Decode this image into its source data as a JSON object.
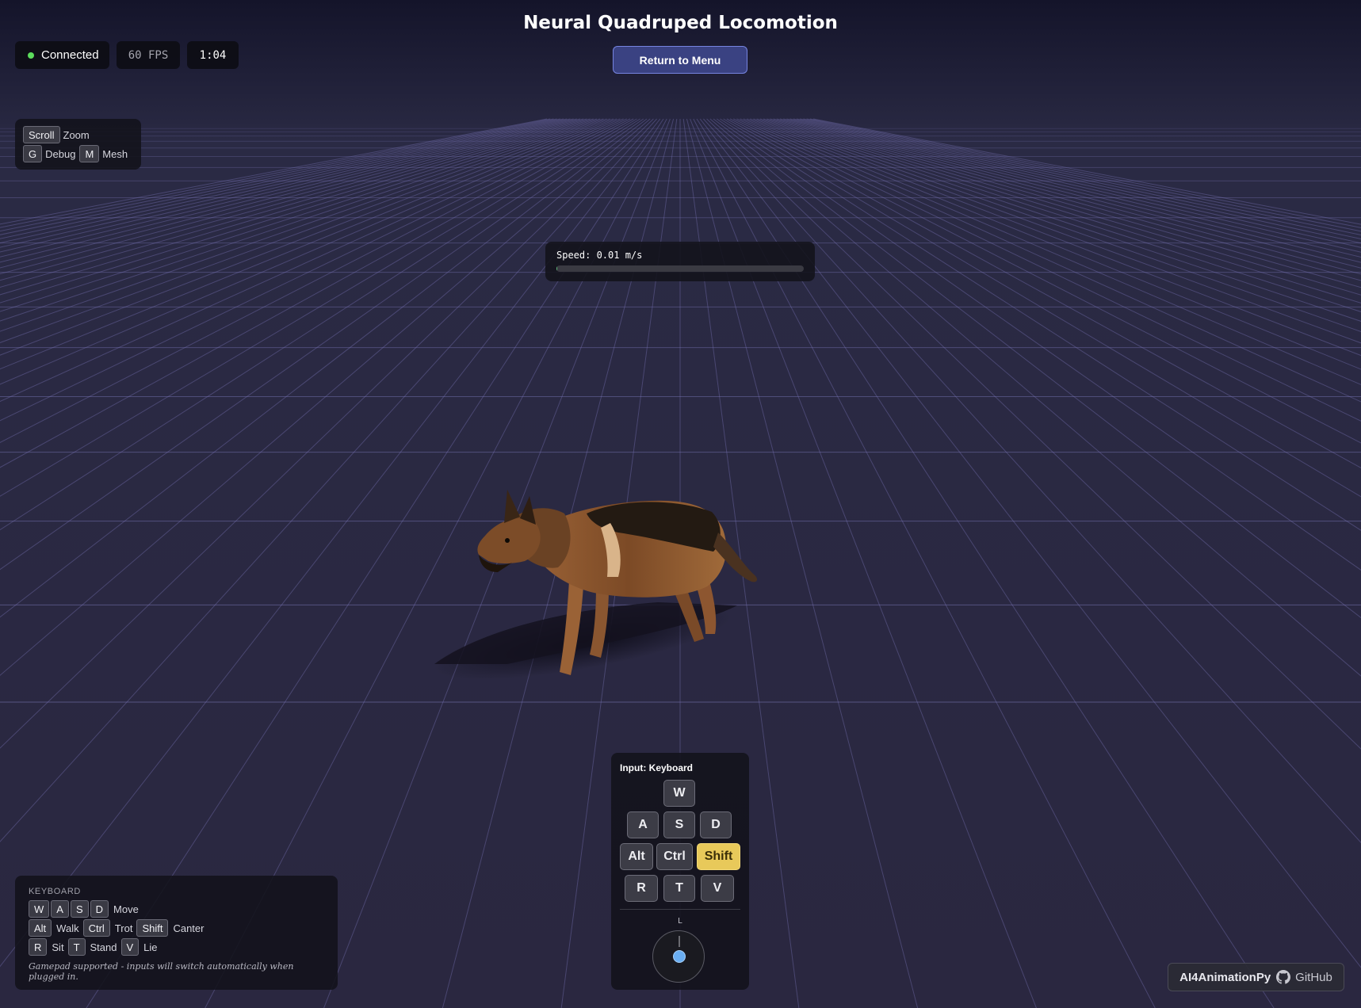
{
  "header": {
    "title": "Neural Quadruped Locomotion",
    "menu_button": "Return to Menu"
  },
  "status": {
    "connection": "Connected",
    "fps": "60 FPS",
    "timer": "1:04",
    "connection_color": "#5cdc5c"
  },
  "camera_controls": {
    "rows": [
      [
        {
          "key": "Scroll",
          "label": "Zoom"
        }
      ],
      [
        {
          "key": "G",
          "label": "Debug"
        },
        {
          "key": "M",
          "label": "Mesh"
        }
      ]
    ]
  },
  "speed": {
    "text": "Speed: 0.01 m/s",
    "fraction": 0.004
  },
  "keyboard_help": {
    "heading": "KEYBOARD",
    "row1": {
      "keys": [
        "W",
        "A",
        "S",
        "D"
      ],
      "label": "Move"
    },
    "row2": {
      "k1": "Alt",
      "l1": "Walk",
      "k2": "Ctrl",
      "l2": "Trot",
      "k3": "Shift",
      "l3": "Canter"
    },
    "row3": {
      "k1": "R",
      "l1": "Sit",
      "k2": "T",
      "l2": "Stand",
      "k3": "V",
      "l3": "Lie"
    },
    "note": "Gamepad supported - inputs will switch automatically when plugged in."
  },
  "input_panel": {
    "title": "Input: Keyboard",
    "keys": {
      "w": "W",
      "a": "A",
      "s": "S",
      "d": "D",
      "alt": "Alt",
      "ctrl": "Ctrl",
      "shift": "Shift",
      "r": "R",
      "t": "T",
      "v": "V"
    },
    "active_key": "Shift",
    "active_color": "#e8c95a",
    "stick_label": "L"
  },
  "footer": {
    "brand": "AI4AnimationPy",
    "github": "GitHub"
  },
  "icons": {
    "status": "status-dot-icon",
    "github": "github-icon"
  },
  "colors": {
    "background": "#2a2740",
    "grid": "#7a76b8",
    "accent": "#3a4282",
    "dog_fur": "#8a5a32"
  }
}
